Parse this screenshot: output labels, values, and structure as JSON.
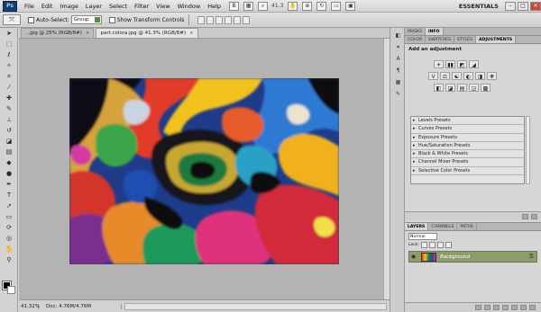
{
  "menubar": {
    "logo": "Ps",
    "items": [
      "File",
      "Edit",
      "Image",
      "Layer",
      "Select",
      "Filter",
      "View",
      "Window",
      "Help"
    ],
    "zoom": "41.3",
    "workspace": "ESSENTIALS",
    "window_controls": [
      "–",
      "□",
      "✕"
    ]
  },
  "options": {
    "auto_select_label": "Auto-Select:",
    "auto_select_value": "Group",
    "transform_label": "Show Transform Controls"
  },
  "tabs": [
    {
      "label": "...jpg @ 25% (RGB/8#)",
      "close": "×"
    },
    {
      "label": "part.colora.jpg @ 41.3% (RGB/8#)",
      "close": "×"
    }
  ],
  "status": {
    "zoom": "41.32%",
    "doc": "Doc: 4.76M/4.76M"
  },
  "panels": {
    "top_tabs": [
      "MASKS",
      "INFO"
    ],
    "sub_tabs": [
      "COLOR",
      "SWATCHES",
      "STYLES",
      "ADJUSTMENTS"
    ],
    "adjustments_title": "Add an adjustment",
    "icon_rows": [
      [
        "☀",
        "▮▮",
        "◩",
        "◢"
      ],
      [
        "V",
        "⚖",
        "☯",
        "◐",
        "◨",
        "❋"
      ],
      [
        "◧",
        "◪",
        "▤",
        "◲",
        "▩"
      ]
    ],
    "presets": [
      "Levels Presets",
      "Curves Presets",
      "Exposure Presets",
      "Hue/Saturation Presets",
      "Black & White Presets",
      "Channel Mixer Presets",
      "Selective Color Presets"
    ]
  },
  "layers": {
    "tabs": [
      "LAYERS",
      "CHANNELS",
      "PATHS"
    ],
    "blend_mode": "Normal",
    "lock_label": "Lock:",
    "layer_name": "Background",
    "eye": "◉",
    "lock_icon": "🔒"
  },
  "panel_icons": [
    "◧",
    "⌗",
    "A",
    "¶",
    "▦",
    "✎"
  ]
}
